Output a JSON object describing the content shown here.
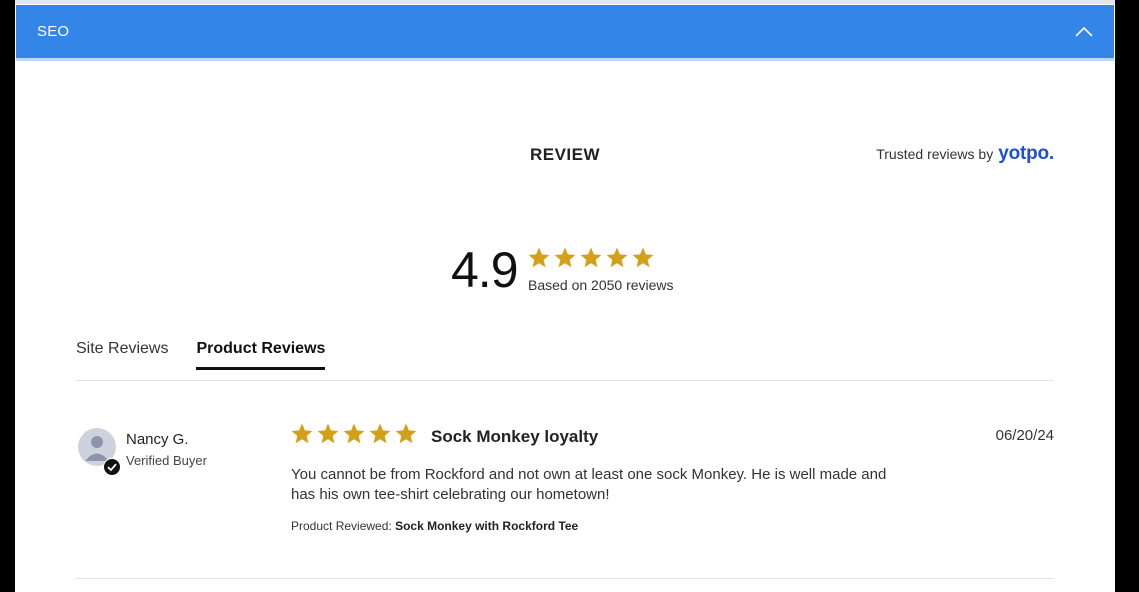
{
  "seo_bar": {
    "label": "SEO",
    "toggle_icon": "chevron-up-icon"
  },
  "review_section": {
    "title": "REVIEW",
    "trusted_prefix": "Trusted reviews by",
    "trusted_brand": "yotpo."
  },
  "summary": {
    "score": "4.9",
    "star_count": 5,
    "based_on": "Based on 2050 reviews"
  },
  "tabs": [
    {
      "label": "Site Reviews",
      "active": false
    },
    {
      "label": "Product Reviews",
      "active": true
    }
  ],
  "reviews": [
    {
      "name": "Nancy G.",
      "badge": "Verified Buyer",
      "stars": 5,
      "title": "Sock Monkey loyalty",
      "date": "06/20/24",
      "body": "You cannot be from Rockford and not own at least one sock Monkey. He is well made and has his own tee-shirt celebrating our hometown!",
      "product_label": "Product Reviewed:",
      "product_name": "Sock Monkey with Rockford Tee"
    }
  ],
  "colors": {
    "accent_blue": "#3386e8",
    "star_gold": "#d4a017",
    "brand_blue": "#1f4fd1"
  }
}
